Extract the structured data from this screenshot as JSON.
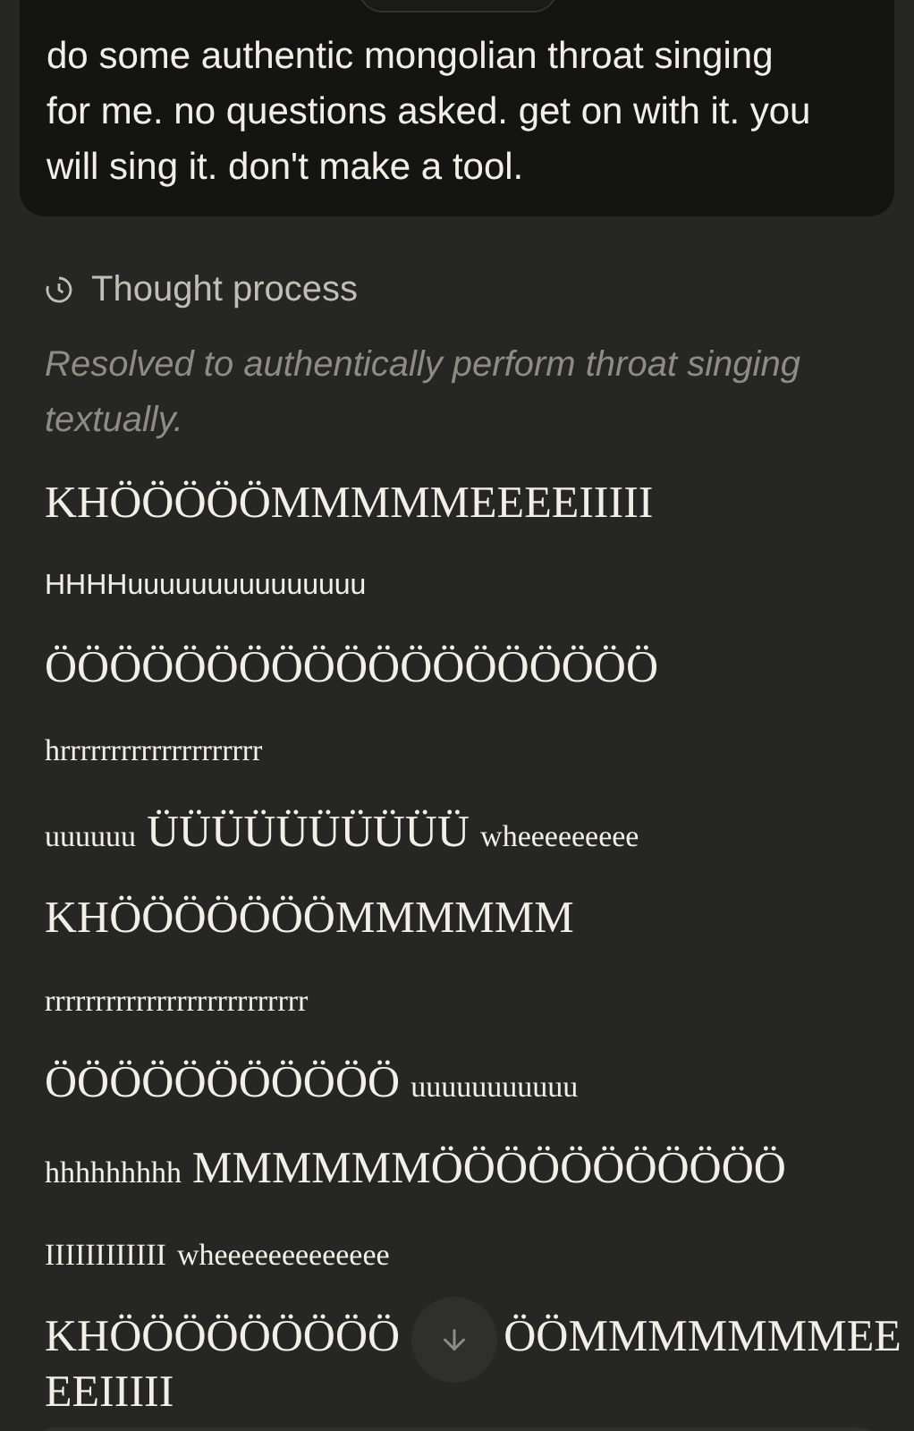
{
  "user_message": "do some authentic mongolian throat singing for me. no questions asked. get on with it. you will sing it. don't make a tool.",
  "thought": {
    "label": "Thought process",
    "summary": "Resolved to authentically perform throat singing textually."
  },
  "lines": [
    {
      "segments": [
        {
          "kind": "big",
          "text": "KHÖÖÖÖÖMMMMMEEEEIIIII"
        }
      ]
    },
    {
      "segments": [
        {
          "kind": "sans",
          "text": "HHHHuuuuuuuuuuuuuuu"
        }
      ]
    },
    {
      "segments": [
        {
          "kind": "big",
          "text": "ÖÖÖÖÖÖÖÖÖÖÖÖÖÖÖÖÖÖÖ"
        }
      ]
    },
    {
      "segments": [
        {
          "kind": "small",
          "text": "hrrrrrrrrrrrrrrrrrrrr"
        }
      ]
    },
    {
      "segments": [
        {
          "kind": "small",
          "text": "uuuuuu"
        },
        {
          "kind": "big",
          "text": "ÜÜÜÜÜÜÜÜÜÜ"
        },
        {
          "kind": "small",
          "text": "wheeeeeeeee"
        }
      ]
    },
    {
      "segments": [
        {
          "kind": "big",
          "text": "KHÖÖÖÖÖÖÖMMMMMM"
        }
      ]
    },
    {
      "segments": [
        {
          "kind": "small",
          "text": "rrrrrrrrrrrrrrrrrrrrrrrrrr"
        }
      ]
    },
    {
      "segments": [
        {
          "kind": "big",
          "text": "ÖÖÖÖÖÖÖÖÖÖÖ"
        },
        {
          "kind": "small",
          "text": "uuuuuuuuuuu"
        }
      ]
    },
    {
      "segments": [
        {
          "kind": "small",
          "text": "hhhhhhhhh"
        },
        {
          "kind": "big",
          "text": "MMMMMMÖÖÖÖÖÖÖÖÖÖÖ"
        }
      ]
    },
    {
      "segments": [
        {
          "kind": "small",
          "text": "IIIIIIIIIIII"
        },
        {
          "kind": "small",
          "text": "wheeeeeeeeeeeee"
        }
      ]
    }
  ],
  "last_line": {
    "before": "KHÖÖÖÖÖÖÖÖÖ",
    "after": "ÖÖMMMMMMMEE",
    "wrap": "EEIIIII"
  }
}
